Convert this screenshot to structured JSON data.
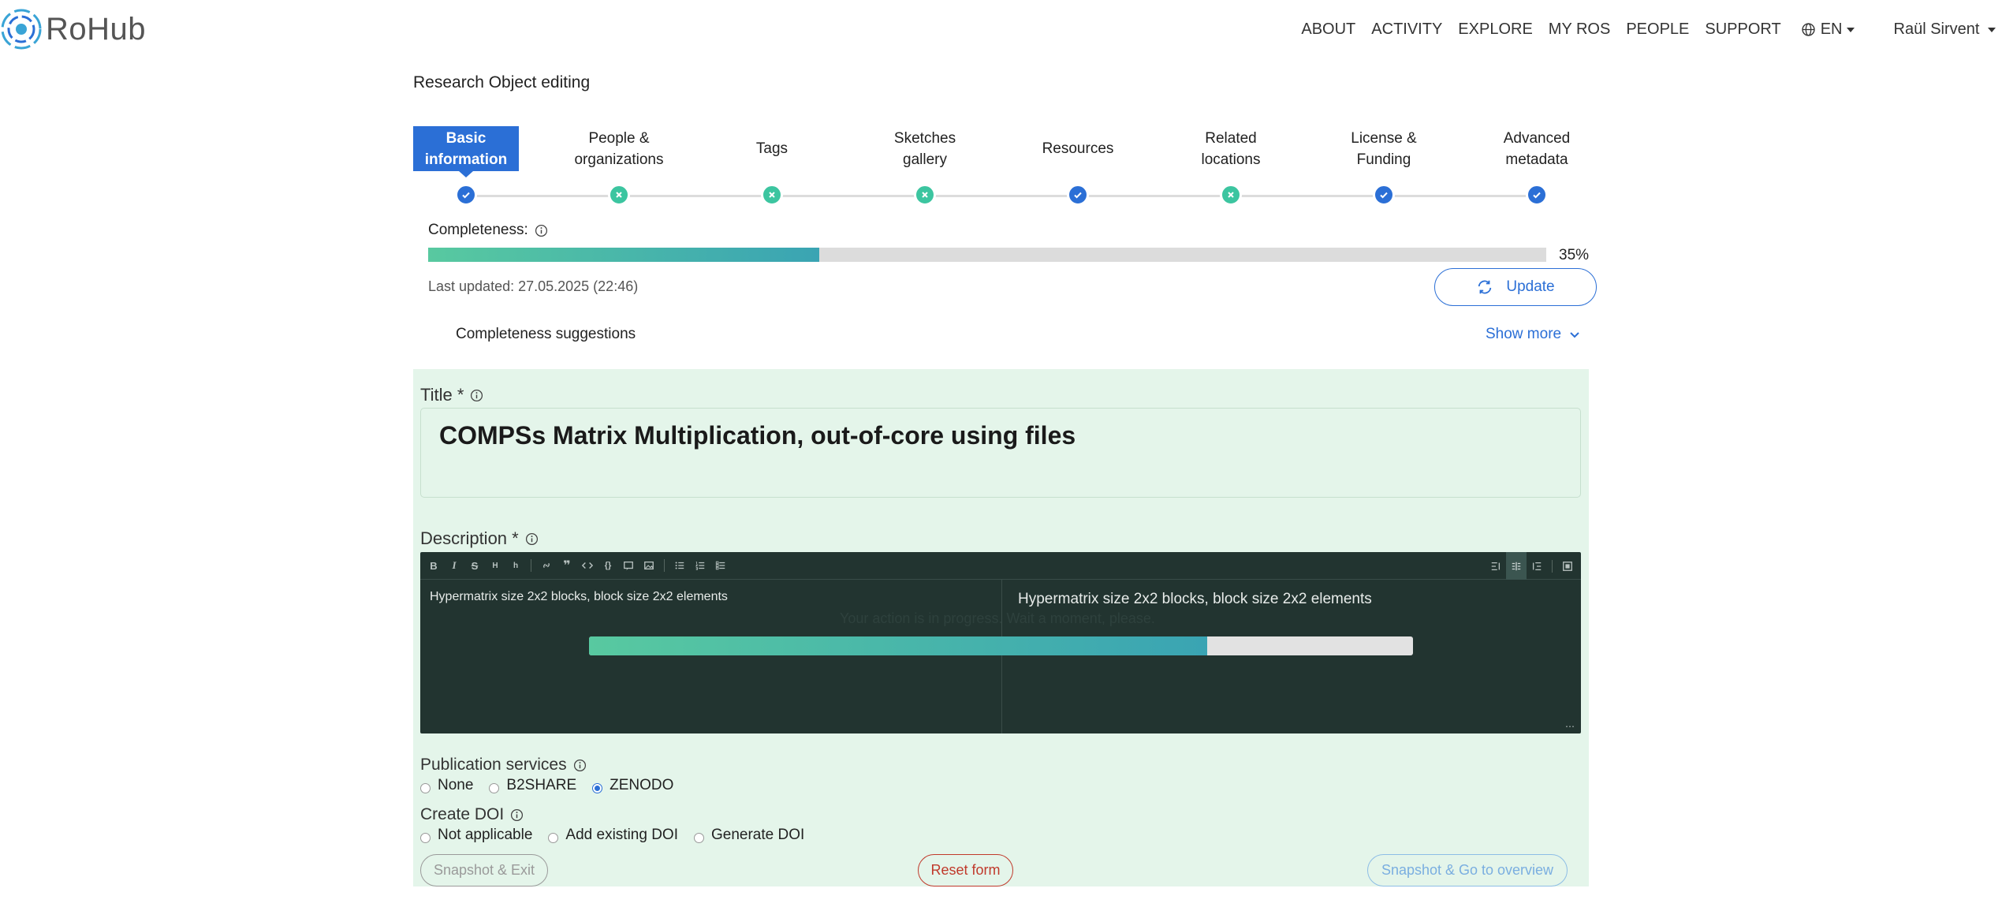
{
  "header": {
    "brand": "RoHub",
    "nav": [
      "ABOUT",
      "ACTIVITY",
      "EXPLORE",
      "MY ROS",
      "PEOPLE",
      "SUPPORT"
    ],
    "language": "EN",
    "user": "Raül Sirvent"
  },
  "page": {
    "title": "Research Object editing"
  },
  "steps": [
    {
      "label": "Basic information",
      "status": "done",
      "active": true
    },
    {
      "label": "People & organizations",
      "status": "missing",
      "active": false
    },
    {
      "label": "Tags",
      "status": "missing",
      "active": false
    },
    {
      "label": "Sketches gallery",
      "status": "missing",
      "active": false
    },
    {
      "label": "Resources",
      "status": "done",
      "active": false
    },
    {
      "label": "Related locations",
      "status": "missing",
      "active": false
    },
    {
      "label": "License & Funding",
      "status": "done",
      "active": false
    },
    {
      "label": "Advanced metadata",
      "status": "done",
      "active": false
    }
  ],
  "completeness": {
    "label": "Completeness:",
    "percent": 35,
    "percent_text": "35%",
    "last_updated": "Last updated: 27.05.2025 (22:46)",
    "update_label": "Update",
    "suggestions_label": "Completeness suggestions",
    "show_more_label": "Show more"
  },
  "form": {
    "title_label": "Title *",
    "title_value": "COMPSs Matrix Multiplication, out-of-core using files",
    "description_label": "Description *",
    "description_value": "Hypermatrix size 2x2 blocks, block size 2x2 elements",
    "description_preview": "Hypermatrix size 2x2 blocks, block size 2x2 elements",
    "busy_text": "Your action is in progress. Wait a moment, please.",
    "busy_progress": 0.75,
    "publication_label": "Publication services",
    "publication_options": [
      "None",
      "B2SHARE",
      "ZENODO"
    ],
    "publication_selected": "ZENODO",
    "doi_label": "Create DOI",
    "doi_options": [
      "Not applicable",
      "Add existing DOI",
      "Generate DOI"
    ],
    "doi_selected": "",
    "snapshot_exit_label": "Snapshot & Exit",
    "reset_label": "Reset form",
    "snapshot_overview_label": "Snapshot & Go to overview"
  },
  "colors": {
    "primary": "#2b6fd6",
    "done": "#2b6fd6",
    "missing": "#3cc5a0",
    "form_bg": "#e4f5ea",
    "editor_bg": "#223430",
    "danger": "#c0392b"
  }
}
